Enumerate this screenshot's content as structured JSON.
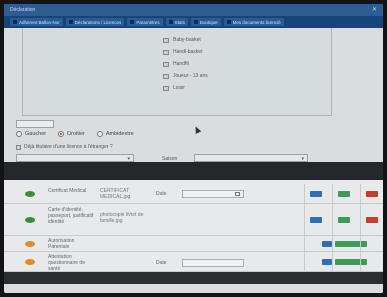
{
  "browser": {
    "title": "Déclaration",
    "user": "",
    "close": "✕",
    "bookmarks": [
      {
        "label": "Adhérent Ballon-Nor"
      },
      {
        "label": "Déclarations / Licences"
      },
      {
        "label": "Paramètres"
      },
      {
        "label": "Stats"
      },
      {
        "label": "Boutique"
      },
      {
        "label": "Mes documents licencié"
      }
    ]
  },
  "form": {
    "categories": [
      "Baby-basket",
      "Handi-basket",
      "Handfit",
      "Joueur - 13 ans",
      "Loisir"
    ],
    "gender_options": [
      {
        "label": "Gaucher",
        "selected": false
      },
      {
        "label": "Droitier",
        "selected": true
      },
      {
        "label": "Ambidextre",
        "selected": false
      }
    ],
    "licence_question": "Déjà titulaire d'une licence à l'étranger ?",
    "select_label": "Saison",
    "select1_value": "",
    "select2_value": ""
  },
  "documents": {
    "rows": [
      {
        "status": "green",
        "name": "Certificat Médical",
        "file": "CERTIFICAT MEDICAL.jpg",
        "date_label": "Date",
        "date_value": "",
        "actions": [
          "blue",
          "green",
          "red"
        ]
      },
      {
        "status": "green",
        "name": "Carte d'identité, passeport, justificatif identité",
        "file": "photocopie livret de famille.jpg",
        "date_label": "",
        "date_value": "",
        "actions": [
          "blue",
          "green",
          "red"
        ]
      },
      {
        "status": "orange",
        "name": "Autorisation Parentale",
        "file": "",
        "date_label": "",
        "date_value": "",
        "actions": [
          "blue-s",
          "green-wide"
        ],
        "action_label": "Parcourir"
      },
      {
        "status": "orange",
        "name": "Attestation questionnaire de santé",
        "file": "",
        "date_label": "Date",
        "date_value": "",
        "actions": [
          "blue-s",
          "green-wide"
        ],
        "action_label": "Parcourir"
      }
    ]
  },
  "footer": {
    "text": ""
  },
  "colors": {
    "titlebar": "#2e5d96",
    "bookmarks_bar": "#17457a",
    "status_green": "#3f8a3a",
    "status_orange": "#e08a2a",
    "action_blue": "#2f6fb8",
    "action_green": "#3d9a5a",
    "action_red": "#c83a2c"
  }
}
